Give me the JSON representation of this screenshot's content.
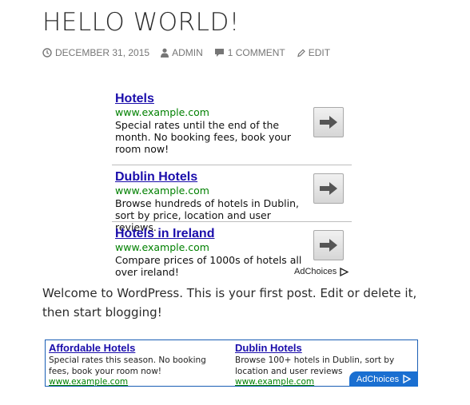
{
  "post": {
    "title": "HELLO WORLD!",
    "date": "DECEMBER 31, 2015",
    "author": "ADMIN",
    "comments": "1 COMMENT",
    "edit": "EDIT",
    "body": "Welcome to WordPress. This is your first post. Edit or delete it, then start blogging!"
  },
  "ad_top": {
    "items": [
      {
        "title": "Hotels",
        "url": "www.example.com",
        "desc": "Special rates until the end of the month. No booking fees, book your room now!"
      },
      {
        "title": "Dublin Hotels",
        "url": "www.example.com",
        "desc": "Browse hundreds of hotels in Dublin, sort by price, location and user reviews."
      },
      {
        "title": "Hotels in Ireland",
        "url": "www.example.com",
        "desc": "Compare prices of 1000s of hotels all over ireland!"
      }
    ],
    "adchoices": "AdChoices"
  },
  "ad_bottom": {
    "items": [
      {
        "title": "Affordable Hotels",
        "desc": "Special rates this season. No booking fees, book your room now!",
        "url": "www.example.com"
      },
      {
        "title": "Dublin Hotels",
        "desc": "Browse 100+ hotels in Dublin, sort by location and user reviews",
        "url": "www.example.com"
      }
    ],
    "adchoices": "AdChoices"
  },
  "icons": {
    "date": "clock-icon",
    "author": "user-icon",
    "comments": "comment-icon",
    "edit": "pencil-icon",
    "ad_arrow": "arrow-right-icon",
    "adchoices": "adchoices-icon"
  },
  "colors": {
    "ad_link": "#1a0dab",
    "ad_url": "#008000",
    "adchoices_bg": "#1a6fd1"
  }
}
